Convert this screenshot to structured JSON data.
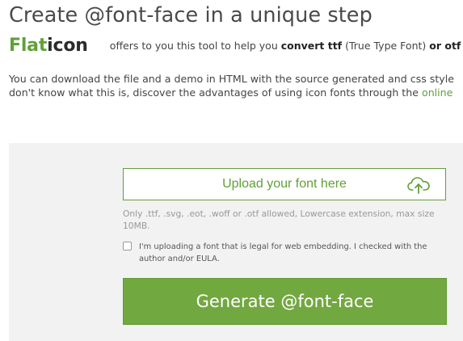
{
  "header": {
    "title": "Create @font-face in a unique step"
  },
  "brand": {
    "logo_part_a": "Flat",
    "logo_part_b": "icon",
    "intro_prefix": "offers to you this tool to help you ",
    "intro_bold": "convert ttf",
    "intro_middle": " (True Type Font) ",
    "intro_bold2": "or otf"
  },
  "description": {
    "line1": "You can download the file and a demo in HTML with the source generated and css style",
    "line2_prefix": "don't know what this is, discover the advantages of using icon fonts through the ",
    "line2_link": "online"
  },
  "upload": {
    "label": "Upload your font here",
    "icon": "cloud-upload-icon",
    "hint": "Only .ttf, .svg, .eot, .woff or .otf allowed, Lowercase extension, max size 10MB."
  },
  "legal": {
    "checked": false,
    "label": "I'm uploading a font that is legal for web embedding. I checked with the author and/or EULA."
  },
  "actions": {
    "generate_label": "Generate @font-face"
  },
  "colors": {
    "brand_green": "#62a038",
    "button_green": "#72a840",
    "panel_bg": "#f2f2f2"
  }
}
